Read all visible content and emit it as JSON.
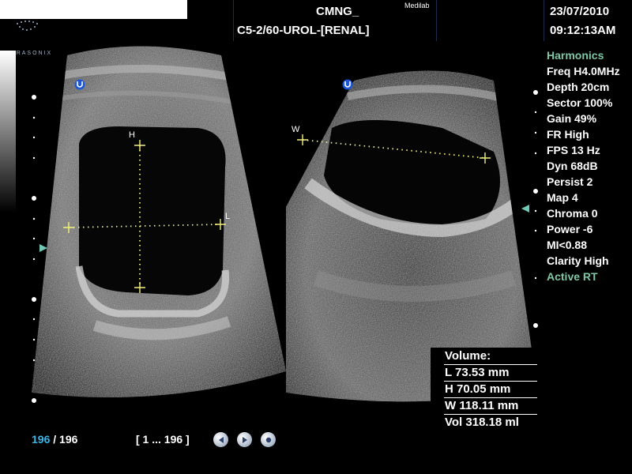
{
  "header": {
    "logo_text": "ULTRASONIX",
    "facility": "CMNG_",
    "lab": "Medilab",
    "probe_preset": "C5-2/60-UROL-[RENAL]",
    "date": "23/07/2010",
    "time": "09:12:13AM"
  },
  "left_view": {
    "marker_h": "H",
    "marker_l": "L"
  },
  "right_view": {
    "marker_w": "W"
  },
  "parameters": [
    {
      "text": "Harmonics",
      "color": "#7fc7a6"
    },
    {
      "text": "Freq H4.0MHz",
      "color": "#ffffff"
    },
    {
      "text": "Depth 20cm",
      "color": "#ffffff"
    },
    {
      "text": "Sector 100%",
      "color": "#ffffff"
    },
    {
      "text": "Gain 49%",
      "color": "#ffffff"
    },
    {
      "text": "FR High",
      "color": "#ffffff"
    },
    {
      "text": "FPS 13 Hz",
      "color": "#ffffff"
    },
    {
      "text": "Dyn 68dB",
      "color": "#ffffff"
    },
    {
      "text": "Persist 2",
      "color": "#ffffff"
    },
    {
      "text": "Map 4",
      "color": "#ffffff"
    },
    {
      "text": "Chroma 0",
      "color": "#ffffff"
    },
    {
      "text": "Power -6",
      "color": "#ffffff"
    },
    {
      "text": "MI<0.88",
      "color": "#ffffff"
    },
    {
      "text": "Clarity High",
      "color": "#ffffff"
    },
    {
      "text": "Active RT",
      "color": "#7fc7a6"
    }
  ],
  "measurements": {
    "title": "Volume:",
    "l": "L 73.53 mm",
    "h": "H 70.05 mm",
    "w": "W 118.11 mm",
    "vol": "Vol 318.18 ml"
  },
  "footer": {
    "frame_current": "196",
    "frame_sep": " / ",
    "frame_total": "196",
    "frame_range": "[ 1 ... 196 ]"
  },
  "controls": {
    "rewind_icon": "rewind-icon",
    "play_icon": "play-icon",
    "stop_icon": "stop-icon"
  },
  "colors": {
    "accent_blue": "#3ab6ea",
    "caliper_yellow": "#f2f07a",
    "param_green": "#7fc7a6",
    "marker_teal": "#6fc9b6"
  }
}
